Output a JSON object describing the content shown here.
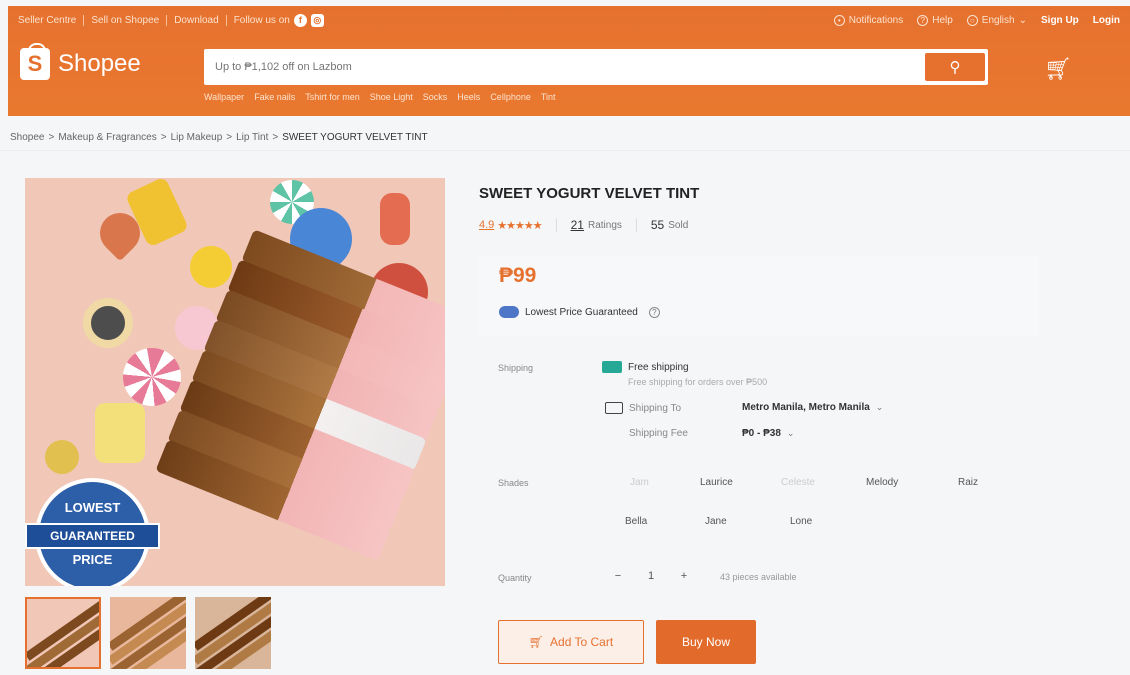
{
  "topbar": {
    "seller_centre": "Seller Centre",
    "sell_on_shopee": "Sell on Shopee",
    "download": "Download",
    "follow_us": "Follow us on",
    "notifications": "Notifications",
    "help": "Help",
    "language": "English",
    "sign_up": "Sign Up",
    "login": "Login"
  },
  "header": {
    "logo_text": "Shopee",
    "logo_letter": "S",
    "search_placeholder": "Up to ₱1,102 off on Lazbom",
    "suggestions": [
      "Wallpaper",
      "Fake nails",
      "Tshirt for men",
      "Shoe Light",
      "Socks",
      "Heels",
      "Cellphone",
      "Tint"
    ]
  },
  "breadcrumb": [
    "Shopee",
    "Makeup & Fragrances",
    "Lip Makeup",
    "Lip Tint",
    "SWEET YOGURT VELVET TINT"
  ],
  "badge": {
    "top": "LOWEST",
    "band": "GUARANTEED",
    "bottom": "PRICE"
  },
  "product": {
    "title": "SWEET YOGURT VELVET TINT",
    "rating": "4.9",
    "stars": "★★★★★",
    "ratings_count": "21",
    "ratings_label": "Ratings",
    "sold_count": "55",
    "sold_label": "Sold",
    "price": "₱99",
    "lowest_price": "Lowest Price Guaranteed"
  },
  "shipping": {
    "label": "Shipping",
    "free_title": "Free shipping",
    "free_sub": "Free shipping for orders over ₱500",
    "to_label": "Shipping To",
    "to_value": "Metro Manila, Metro Manila",
    "fee_label": "Shipping Fee",
    "fee_value": "₱0 - ₱38"
  },
  "shades": {
    "label": "Shades",
    "options": [
      "Jam",
      "Laurice",
      "Celeste",
      "Melody",
      "Raiz",
      "Bella",
      "Jane",
      "Lone"
    ]
  },
  "quantity": {
    "label": "Quantity",
    "minus": "−",
    "value": "1",
    "plus": "+",
    "available": "43 pieces available"
  },
  "actions": {
    "add_to_cart": "Add To Cart",
    "buy_now": "Buy Now"
  },
  "colors": {
    "brand": "#e6712f",
    "free_ship": "#25a896"
  }
}
